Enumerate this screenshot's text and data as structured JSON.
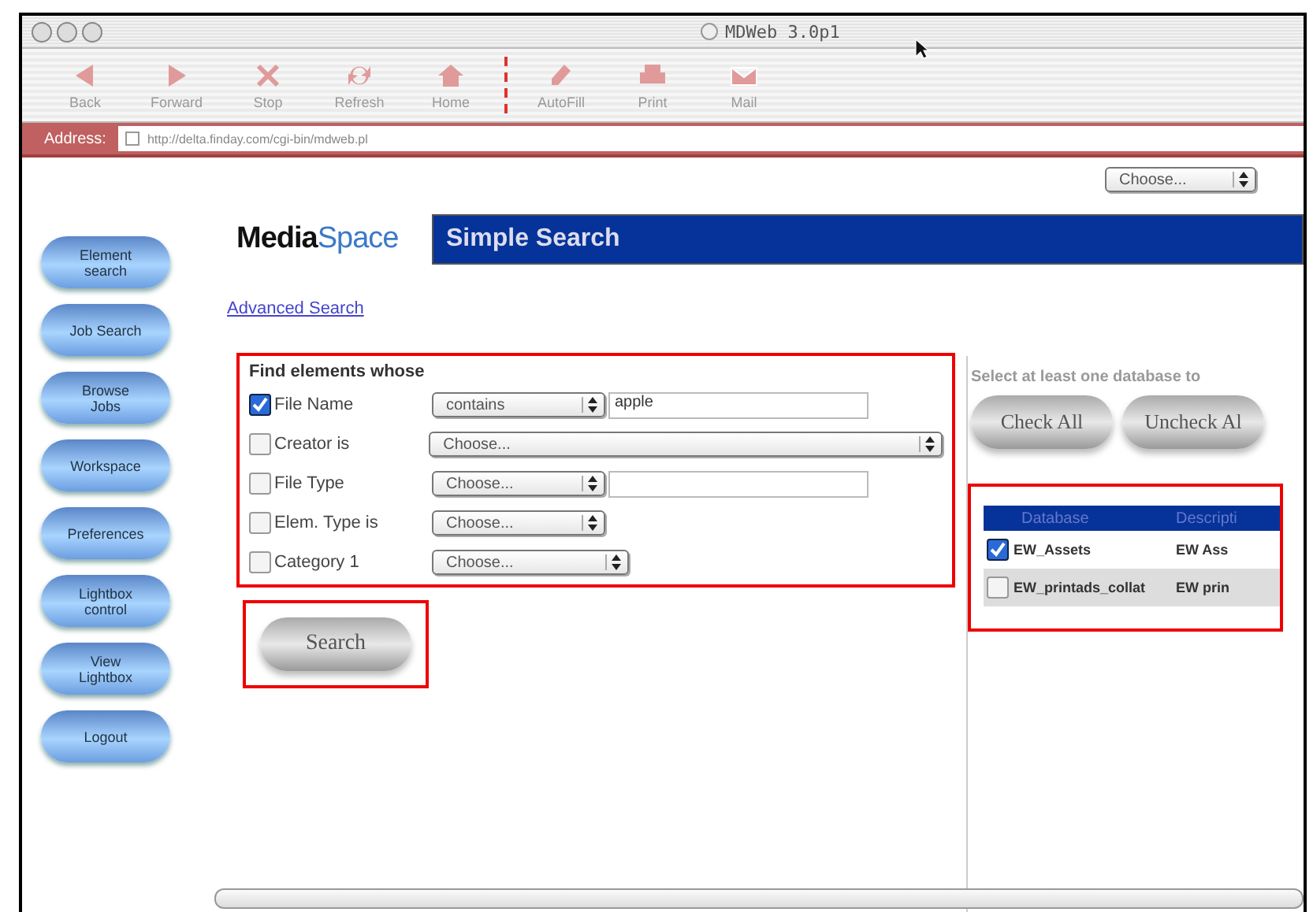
{
  "window": {
    "title": "MDWeb 3.0p1"
  },
  "toolbar": {
    "groups": [
      [
        {
          "label": "Back"
        },
        {
          "label": "Forward"
        },
        {
          "label": "Stop"
        },
        {
          "label": "Refresh"
        },
        {
          "label": "Home"
        }
      ],
      [
        {
          "label": "AutoFill"
        },
        {
          "label": "Print"
        },
        {
          "label": "Mail"
        }
      ]
    ]
  },
  "address": {
    "label": "Address:",
    "value": "http://delta.finday.com/cgi-bin/mdweb.pl"
  },
  "top_chooser": {
    "value": "Choose..."
  },
  "sidebar": {
    "items": [
      {
        "lines": [
          "Element",
          "search"
        ]
      },
      {
        "lines": [
          "Job Search"
        ]
      },
      {
        "lines": [
          "Browse",
          "Jobs"
        ]
      },
      {
        "lines": [
          "Workspace"
        ]
      },
      {
        "lines": [
          "Preferences"
        ]
      },
      {
        "lines": [
          "Lightbox",
          "control"
        ]
      },
      {
        "lines": [
          "View",
          "Lightbox"
        ]
      },
      {
        "lines": [
          "Logout"
        ]
      }
    ]
  },
  "logo": {
    "bold": "Media",
    "light": "Space"
  },
  "header": {
    "title": "Simple Search"
  },
  "advanced_link": "Advanced Search",
  "form": {
    "highlighted": true,
    "heading": "Find elements whose",
    "rows": [
      {
        "kind": "with-field",
        "checked": true,
        "label": "File Name",
        "choice": "contains",
        "field_value": "apple"
      },
      {
        "kind": "wide",
        "checked": false,
        "label": "Creator is",
        "choice": "Choose..."
      },
      {
        "kind": "with-field",
        "checked": false,
        "label": "File Type",
        "choice": "Choose..."
      },
      {
        "kind": "plain",
        "checked": false,
        "label": "Elem. Type is",
        "choice": "Choose..."
      },
      {
        "kind": "long",
        "checked": false,
        "label": "Category 1",
        "choice": "Choose..."
      }
    ]
  },
  "search_button": {
    "label": "Search",
    "highlighted": true
  },
  "databases": {
    "instruction": "Select at least one database to",
    "buttons": [
      "Check All",
      "Uncheck Al"
    ],
    "table": {
      "highlighted": true,
      "columns": [
        "Database",
        "Descripti"
      ],
      "rows": [
        {
          "checked": true,
          "name": "EW_Assets",
          "description": "EW Ass"
        },
        {
          "checked": false,
          "name": "EW_printads_collat",
          "description": "EW prin"
        }
      ]
    }
  }
}
